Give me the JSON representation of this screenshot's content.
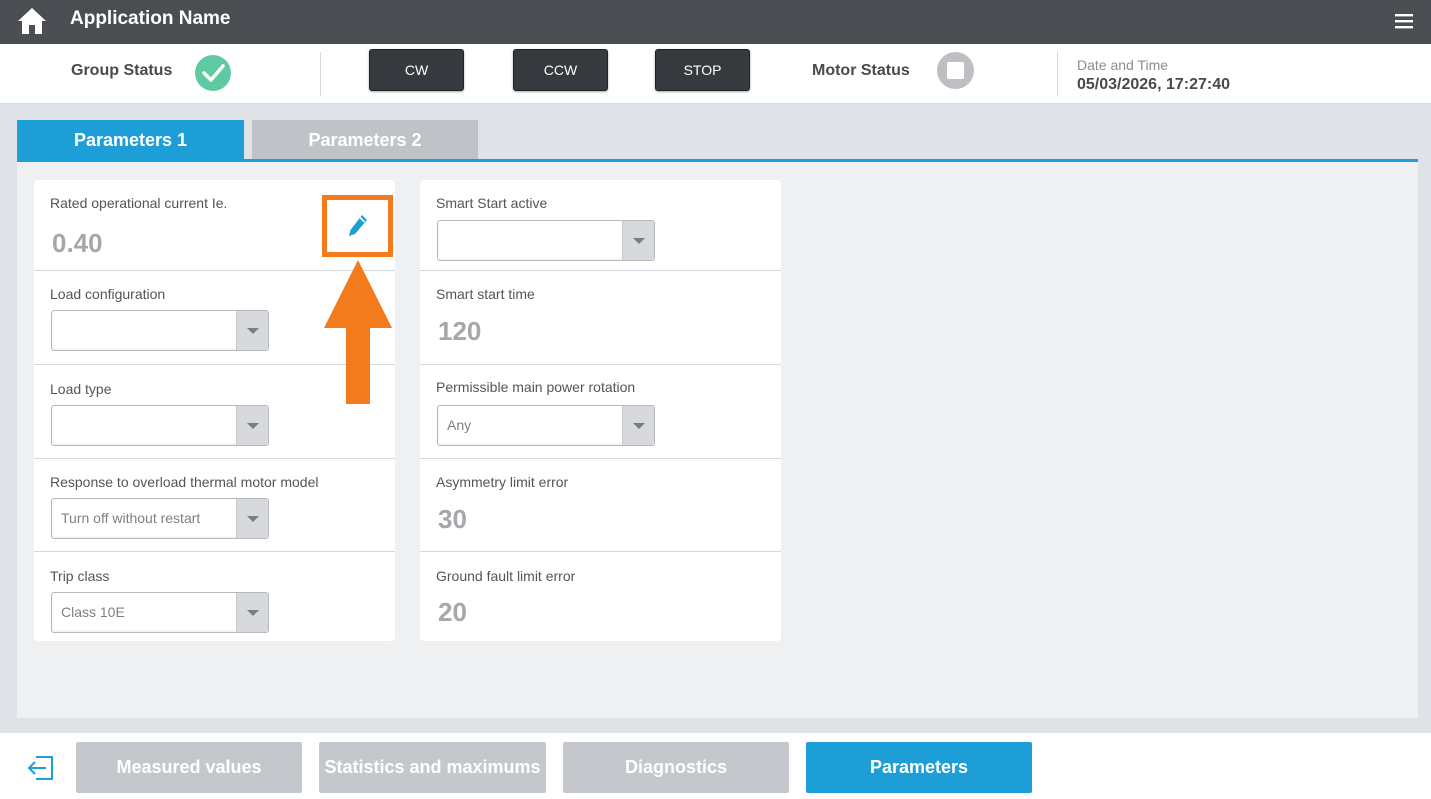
{
  "header": {
    "title": "Application Name",
    "home_icon": "home-icon",
    "menu_icon": "hamburger-menu-icon"
  },
  "status": {
    "group_status_label": "Group Status",
    "group_status_icon": "check-circle-icon",
    "buttons": {
      "cw": "CW",
      "ccw": "CCW",
      "stop": "STOP"
    },
    "motor_status_label": "Motor Status",
    "motor_status_icon": "stop-square-icon",
    "date_time_label": "Date and Time",
    "date_time_value": "05/03/2026, 17:27:40"
  },
  "tabs": [
    {
      "label": "Parameters 1",
      "active": true
    },
    {
      "label": "Parameters 2",
      "active": false
    }
  ],
  "left_params": {
    "rated_current_label": "Rated operational current Ie.",
    "rated_current_value": "0.40",
    "load_configuration_label": "Load configuration",
    "load_configuration_value": "",
    "load_type_label": "Load type",
    "load_type_value": "",
    "overload_response_label": "Response to overload thermal motor model",
    "overload_response_value": "Turn off without restart",
    "trip_class_label": "Trip class",
    "trip_class_value": "Class 10E"
  },
  "right_params": {
    "smart_start_active_label": "Smart Start active",
    "smart_start_active_value": "",
    "smart_start_time_label": "Smart start time",
    "smart_start_time_value": "120",
    "main_power_rotation_label": "Permissible main power rotation",
    "main_power_rotation_value": "Any",
    "asymmetry_limit_label": "Asymmetry limit error",
    "asymmetry_limit_value": "30",
    "ground_fault_label": "Ground fault limit error",
    "ground_fault_value": "20"
  },
  "highlight": {
    "edit_icon": "pencil-edit-icon",
    "accent_color": "#f47a1e"
  },
  "bottom_nav": {
    "exit_icon": "exit-icon",
    "items": [
      {
        "label": "Measured values",
        "active": false
      },
      {
        "label": "Statistics and maximums",
        "active": false
      },
      {
        "label": "Diagnostics",
        "active": false
      },
      {
        "label": "Parameters",
        "active": true
      }
    ]
  },
  "colors": {
    "accent_blue": "#1e9ed6",
    "topbar": "#4a4d51",
    "status_ok": "#5fcaa2",
    "button_dark": "#36393d"
  }
}
